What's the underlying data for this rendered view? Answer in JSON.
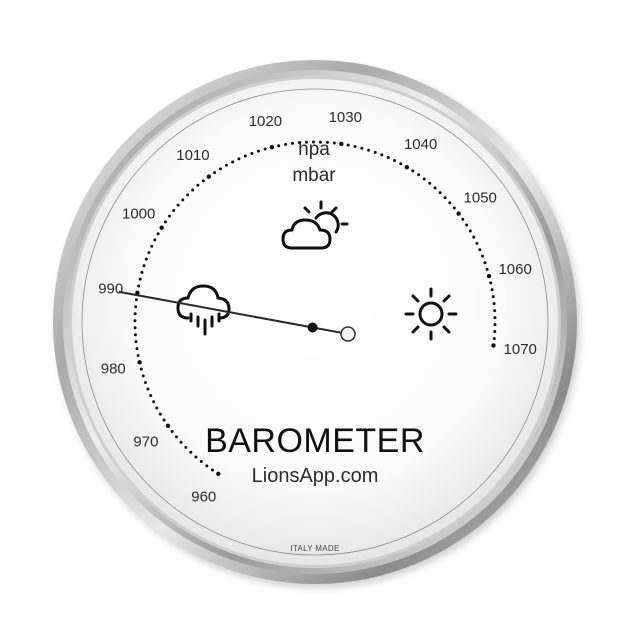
{
  "app": {
    "name": "Barometer",
    "title": "BAROMETER",
    "website": "LionsApp.com",
    "made_in": "ITALY MADE"
  },
  "dial": {
    "units": [
      "hpa",
      "mbar"
    ],
    "scale_min": 960,
    "scale_max": 1070,
    "tick_labels": [
      "960",
      "970",
      "980",
      "990",
      "1000",
      "1010",
      "1020",
      "1030",
      "1040",
      "1050",
      "1060",
      "1070"
    ],
    "needle_value": 990.5,
    "icons": [
      "rain-cloud-icon",
      "partly-sunny-icon",
      "sun-icon"
    ]
  },
  "colors": {
    "bezel_dark": "#8c8c8c",
    "bezel_light": "#f4f4f4",
    "face": "#ffffff",
    "ink": "#111111",
    "needle": "#2a2a2a"
  }
}
